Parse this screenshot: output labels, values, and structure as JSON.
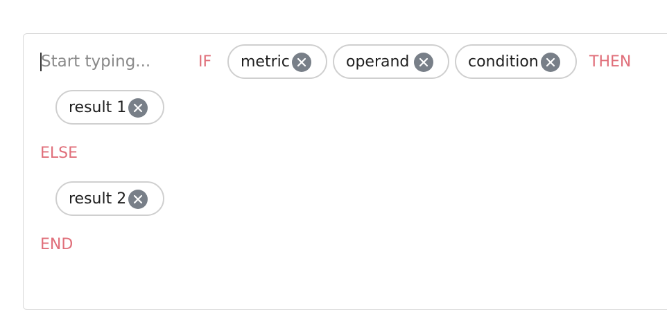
{
  "editor": {
    "placeholder": "Start typing..."
  },
  "keywords": {
    "if": "IF",
    "then": "THEN",
    "else": "ELSE",
    "end": "END"
  },
  "chips": {
    "metric": "metric",
    "operand": "operand",
    "condition": "condition",
    "result_1": "result 1",
    "result_2": "result 2"
  },
  "icons": {
    "remove": "close-icon"
  },
  "colors": {
    "keyword": "#e06f7a",
    "chip_border": "#cfcfcf",
    "remove_button": "#787f88"
  }
}
